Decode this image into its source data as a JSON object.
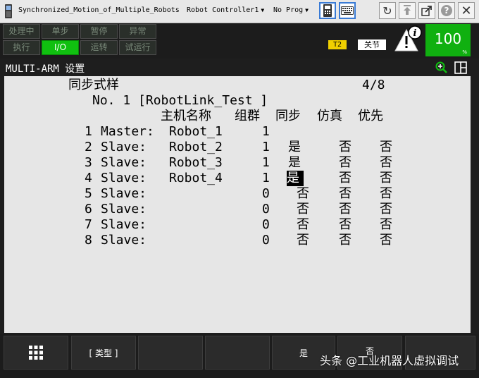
{
  "titlebar": {
    "title": "Synchronized_Motion_of_Multiple_Robots",
    "controller": "Robot Controller1",
    "program": "No Prog"
  },
  "status": {
    "indicators": [
      {
        "label": "处理中",
        "on": false
      },
      {
        "label": "单步",
        "on": false
      },
      {
        "label": "暂停",
        "on": false
      },
      {
        "label": "异常",
        "on": false
      },
      {
        "label": "执行",
        "on": false
      },
      {
        "label": "I/O",
        "on": true
      },
      {
        "label": "运转",
        "on": false
      },
      {
        "label": "试运行",
        "on": false
      }
    ],
    "mode_badge": "T2",
    "state_badge": "关节",
    "override_value": "100",
    "override_unit": "%"
  },
  "header": {
    "title": "MULTI-ARM 设置"
  },
  "screen": {
    "title": "同步式样",
    "page": "4/8",
    "program_line": "No. 1 [RobotLink_Test          ]",
    "columns": [
      "主机名称",
      "组群",
      "同步",
      "仿真",
      "优先"
    ],
    "rows": [
      {
        "index": "1",
        "role": "Master:",
        "robot": "Robot_1",
        "group": "1",
        "sync": "",
        "sim": "",
        "priority": ""
      },
      {
        "index": "2",
        "role": "Slave:",
        "robot": "Robot_2",
        "group": "1",
        "sync": "是",
        "sim": "否",
        "priority": "否"
      },
      {
        "index": "3",
        "role": "Slave:",
        "robot": "Robot_3",
        "group": "1",
        "sync": "是",
        "sim": "否",
        "priority": "否"
      },
      {
        "index": "4",
        "role": "Slave:",
        "robot": "Robot_4",
        "group": "1",
        "sync": "是",
        "sim": "否",
        "priority": "否",
        "selected": true
      },
      {
        "index": "5",
        "role": "Slave:",
        "robot": "",
        "group": "0",
        "sync": "否",
        "sim": "否",
        "priority": "否"
      },
      {
        "index": "6",
        "role": "Slave:",
        "robot": "",
        "group": "0",
        "sync": "否",
        "sim": "否",
        "priority": "否"
      },
      {
        "index": "7",
        "role": "Slave:",
        "robot": "",
        "group": "0",
        "sync": "否",
        "sim": "否",
        "priority": "否"
      },
      {
        "index": "8",
        "role": "Slave:",
        "robot": "",
        "group": "0",
        "sync": "否",
        "sim": "否",
        "priority": "否"
      }
    ]
  },
  "function_keys": [
    "",
    "[ 类型 ]",
    "",
    "",
    "是",
    "否",
    ""
  ],
  "watermark": "头条 @工业机器人虚拟调试"
}
